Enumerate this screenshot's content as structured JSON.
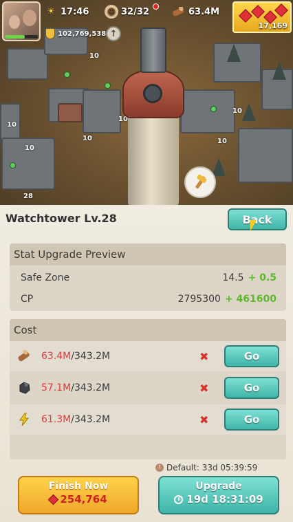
{
  "hud": {
    "time": "17:46",
    "population": "32/32",
    "wood": "63.4M",
    "power": "102,769,538",
    "gems": "17,169"
  },
  "world": {
    "building_levels": [
      "10",
      "10",
      "10",
      "10",
      "10",
      "10",
      "28",
      "10"
    ]
  },
  "panel": {
    "title": "Watchtower Lv.28",
    "back_label": "Back",
    "preview": {
      "heading": "Stat Upgrade Preview",
      "stats": [
        {
          "name": "Safe Zone",
          "current": "14.5",
          "increase": "+ 0.5"
        },
        {
          "name": "CP",
          "current": "2795300",
          "increase": "+ 461600"
        }
      ]
    },
    "cost": {
      "heading": "Cost",
      "rows": [
        {
          "resource": "wood-icon",
          "have": "63.4M",
          "need": "/343.2M",
          "go": "Go"
        },
        {
          "resource": "stone-icon",
          "have": "57.1M",
          "need": "/343.2M",
          "go": "Go"
        },
        {
          "resource": "energy-icon",
          "have": "61.3M",
          "need": "/343.2M",
          "go": "Go"
        }
      ]
    },
    "default_time": "Default: 33d 05:39:59",
    "finish": {
      "label": "Finish Now",
      "cost": "254,764"
    },
    "upgrade": {
      "label": "Upgrade",
      "time": "19d 18:31:09"
    }
  },
  "colors": {
    "teal_button": "#3fb5a8",
    "gold_button": "#f0a82a",
    "insufficient": "#e03a3a",
    "gain": "#5cb82c"
  }
}
